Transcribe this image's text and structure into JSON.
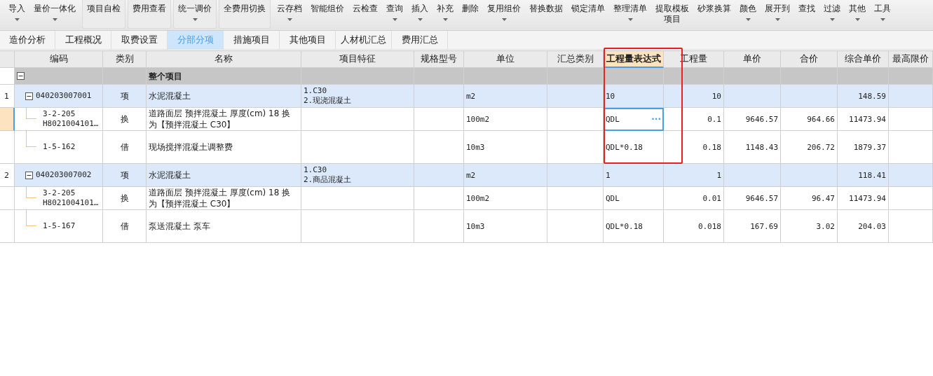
{
  "toolbar": [
    {
      "items": [
        {
          "label": "导入",
          "dropdown": true
        },
        {
          "label": "量价一体化",
          "dropdown": true
        }
      ]
    },
    {
      "items": [
        {
          "label": "项目自检",
          "dropdown": false
        }
      ]
    },
    {
      "items": [
        {
          "label": "费用查看",
          "dropdown": false
        }
      ]
    },
    {
      "items": [
        {
          "label": "统一调价",
          "dropdown": true
        }
      ]
    },
    {
      "items": [
        {
          "label": "全费用切换",
          "dropdown": false
        }
      ]
    },
    {
      "items": [
        {
          "label": "云存档",
          "dropdown": true
        },
        {
          "label": "智能组价",
          "dropdown": false
        },
        {
          "label": "云检查",
          "dropdown": false
        },
        {
          "label": "查询",
          "dropdown": true
        },
        {
          "label": "插入",
          "dropdown": true
        },
        {
          "label": "补充",
          "dropdown": true
        },
        {
          "label": "删除",
          "dropdown": false
        },
        {
          "label": "复用组价",
          "dropdown": true
        },
        {
          "label": "替换数据",
          "dropdown": false
        },
        {
          "label": "锁定清单",
          "dropdown": false
        },
        {
          "label": "整理清单",
          "dropdown": true
        },
        {
          "label_lines": [
            "提取模板",
            "项目"
          ]
        },
        {
          "label": "砂浆换算",
          "dropdown": false
        },
        {
          "label": "颜色",
          "dropdown": true
        },
        {
          "label": "展开到",
          "dropdown": true
        },
        {
          "label": "查找",
          "dropdown": false
        },
        {
          "label": "过滤",
          "dropdown": true
        },
        {
          "label": "其他",
          "dropdown": true
        },
        {
          "label": "工具",
          "dropdown": true
        }
      ]
    }
  ],
  "tabs": [
    {
      "label": "造价分析",
      "selected": false
    },
    {
      "label": "工程概况",
      "selected": false
    },
    {
      "label": "取费设置",
      "selected": false
    },
    {
      "label": "分部分项",
      "selected": true
    },
    {
      "label": "措施项目",
      "selected": false
    },
    {
      "label": "其他项目",
      "selected": false
    },
    {
      "label": "人材机汇总",
      "selected": false
    },
    {
      "label": "费用汇总",
      "selected": false
    }
  ],
  "columns": [
    {
      "label": "编码",
      "highlighted": false
    },
    {
      "label": "类别",
      "highlighted": false
    },
    {
      "label": "名称",
      "highlighted": false
    },
    {
      "label": "项目特征",
      "highlighted": false
    },
    {
      "label": "规格型号",
      "highlighted": false
    },
    {
      "label": "单位",
      "highlighted": false
    },
    {
      "label": "汇总类别",
      "highlighted": false
    },
    {
      "label": "工程量表达式",
      "highlighted": true
    },
    {
      "label": "工程量",
      "highlighted": false
    },
    {
      "label": "单价",
      "highlighted": false
    },
    {
      "label": "合价",
      "highlighted": false
    },
    {
      "label": "综合单价",
      "highlighted": false
    },
    {
      "label": "最高限价",
      "highlighted": false
    }
  ],
  "rows": [
    {
      "kind": "group",
      "name": "整个项目",
      "expanded": true,
      "selected": false,
      "children": [
        {
          "kind": "item",
          "row_no": "1",
          "expanded": true,
          "selected": false,
          "code": [
            "040203007001"
          ],
          "type": "项",
          "name": "水泥混凝土",
          "features": [
            "1.C30",
            "2.现浇混凝土"
          ],
          "unit": "m2",
          "expr": "10",
          "qty": "10",
          "unit_total": "148.59",
          "children": [
            {
              "kind": "sub",
              "selected": true,
              "code": [
                "3-2-205",
                "H8021004101…"
              ],
              "type": "换",
              "name": "道路面层 预拌混凝土 厚度(cm) 18  换为【预拌混凝土 C30】",
              "unit": "100m2",
              "expr": "QDL",
              "expr_button": "···",
              "qty": "0.1",
              "price": "9646.57",
              "total": "964.66",
              "unit_total": "11473.94"
            },
            {
              "kind": "sub",
              "selected": false,
              "code": [
                "1-5-162"
              ],
              "type": "借",
              "name": "现场搅拌混凝土调整费",
              "unit": "10m3",
              "expr": "QDL*0.18",
              "qty": "0.18",
              "price": "1148.43",
              "total": "206.72",
              "unit_total": "1879.37"
            }
          ]
        },
        {
          "kind": "item",
          "row_no": "2",
          "expanded": true,
          "selected": false,
          "code": [
            "040203007002"
          ],
          "type": "项",
          "name": "水泥混凝土",
          "features": [
            "1.C30",
            "2.商品混凝土"
          ],
          "unit": "m2",
          "expr": "1",
          "qty": "1",
          "unit_total": "118.41",
          "children": [
            {
              "kind": "sub",
              "selected": false,
              "code": [
                "3-2-205",
                "H8021004101…"
              ],
              "type": "换",
              "name": "道路面层 预拌混凝土 厚度(cm) 18  换为【预拌混凝土 C30】",
              "unit": "100m2",
              "expr": "QDL",
              "qty": "0.01",
              "price": "9646.57",
              "total": "96.47",
              "unit_total": "11473.94"
            },
            {
              "kind": "sub",
              "selected": false,
              "code": [
                "1-5-167"
              ],
              "type": "借",
              "name": "泵送混凝土 泵车",
              "unit": "10m3",
              "expr": "QDL*0.18",
              "qty": "0.018",
              "price": "167.69",
              "total": "3.02",
              "unit_total": "204.03"
            }
          ]
        }
      ]
    }
  ],
  "annotation": {
    "kind": "red_box"
  }
}
